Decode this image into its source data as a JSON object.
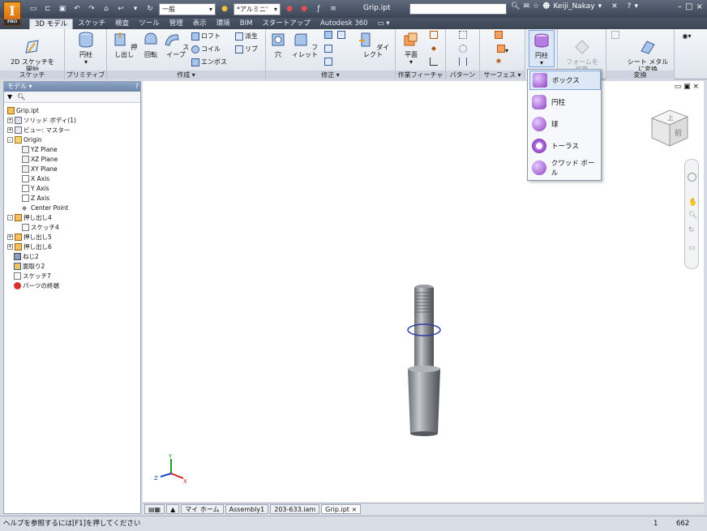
{
  "titlebar": {
    "material_combo": "一般",
    "appearance_combo": "*アルミニ'",
    "doc_title": "Grip.ipt",
    "user": "Keiji_Nakay",
    "app_badge": "PRO",
    "app_letter": "I"
  },
  "tabs": [
    "3D モデル",
    "スケッチ",
    "検査",
    "ツール",
    "管理",
    "表示",
    "環境",
    "BIM",
    "スタートアップ",
    "Autodesk 360"
  ],
  "ribbon": {
    "sketch": {
      "button": "2D スケッチを\n開始",
      "title": "スケッチ"
    },
    "primitive": {
      "button": "円柱",
      "title": "プリミティブ"
    },
    "create": {
      "title": "作成 ▾",
      "extrude": "押し出し",
      "revolve": "回転",
      "sweep": "スイープ",
      "loft": "ロフト",
      "coil": "コイル",
      "emboss": "エンボス",
      "derive": "派生",
      "rib": "リブ"
    },
    "modify": {
      "title": "修正 ▾",
      "hole": "穴",
      "fillet": "フィレット",
      "direct": "ダイレクト"
    },
    "workfeature": {
      "title": "作業フィーチャ",
      "plane": "平面"
    },
    "pattern": {
      "title": "パターン"
    },
    "surface": {
      "title": "サーフェス ▾"
    },
    "freeform": {
      "button": "円柱"
    },
    "convert": {
      "form": "フォームを\n編集",
      "sheetmetal": "シート メタル\nに変換",
      "title": "変換"
    }
  },
  "browser": {
    "title": "モデル ▾",
    "items": [
      {
        "label": "Grip.ipt"
      },
      {
        "label": "ソリッド ボディ(1)"
      },
      {
        "label": "ビュー: マスター"
      },
      {
        "label": "Origin"
      },
      {
        "label": "YZ Plane"
      },
      {
        "label": "XZ Plane"
      },
      {
        "label": "XY Plane"
      },
      {
        "label": "X Axis"
      },
      {
        "label": "Y Axis"
      },
      {
        "label": "Z Axis"
      },
      {
        "label": "Center Point"
      },
      {
        "label": "押し出し4"
      },
      {
        "label": "スケッチ4"
      },
      {
        "label": "押し出し5"
      },
      {
        "label": "押し出し6"
      },
      {
        "label": "ねじ2"
      },
      {
        "label": "面取り2"
      },
      {
        "label": "スケッチ7"
      },
      {
        "label": "パーツの終端"
      }
    ]
  },
  "dropdown": {
    "items": [
      {
        "label": "ボックス"
      },
      {
        "label": "円柱"
      },
      {
        "label": "球"
      },
      {
        "label": "トーラス"
      },
      {
        "label": "クワッド ボール"
      }
    ]
  },
  "viewcube": {
    "face_top": "上",
    "face_front": "前"
  },
  "triad": {
    "x": "X",
    "y": "Y",
    "z": "Z"
  },
  "doctabs": [
    "マイ ホーム",
    "Assembly1",
    "203-633.iam",
    "Grip.ipt"
  ],
  "status": {
    "help": "ヘルプを参照するには[F1]を押してください",
    "count1": "1",
    "count2": "662"
  }
}
